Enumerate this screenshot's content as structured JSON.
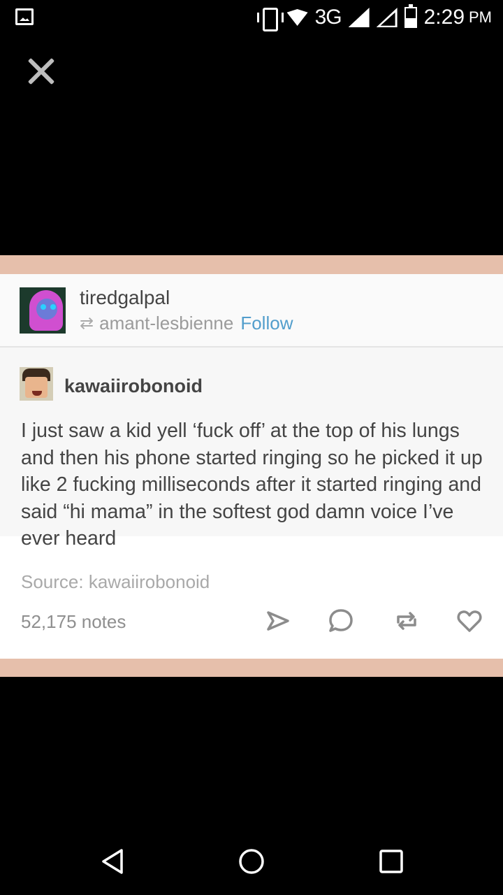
{
  "status_bar": {
    "network": "3G",
    "time": "2:29",
    "ampm": "PM"
  },
  "post": {
    "reblogger": "tiredgalpal",
    "reblogged_from": "amant-lesbienne",
    "follow_label": "Follow",
    "original_author": "kawaiirobonoid",
    "text": "I just saw a kid yell ‘fuck off’ at the top of his lungs and then his phone started ringing so he picked it up like 2 fucking milliseconds after it started ringing and said “hi mama” in the softest god damn voice I’ve ever heard",
    "source": "Source: kawaiirobonoid",
    "notes": "52,175 notes"
  },
  "colors": {
    "background": "#000000",
    "post_border": "#e6bfab",
    "follow": "#529ecc",
    "text": "#444444",
    "muted": "#a9a9a9"
  }
}
